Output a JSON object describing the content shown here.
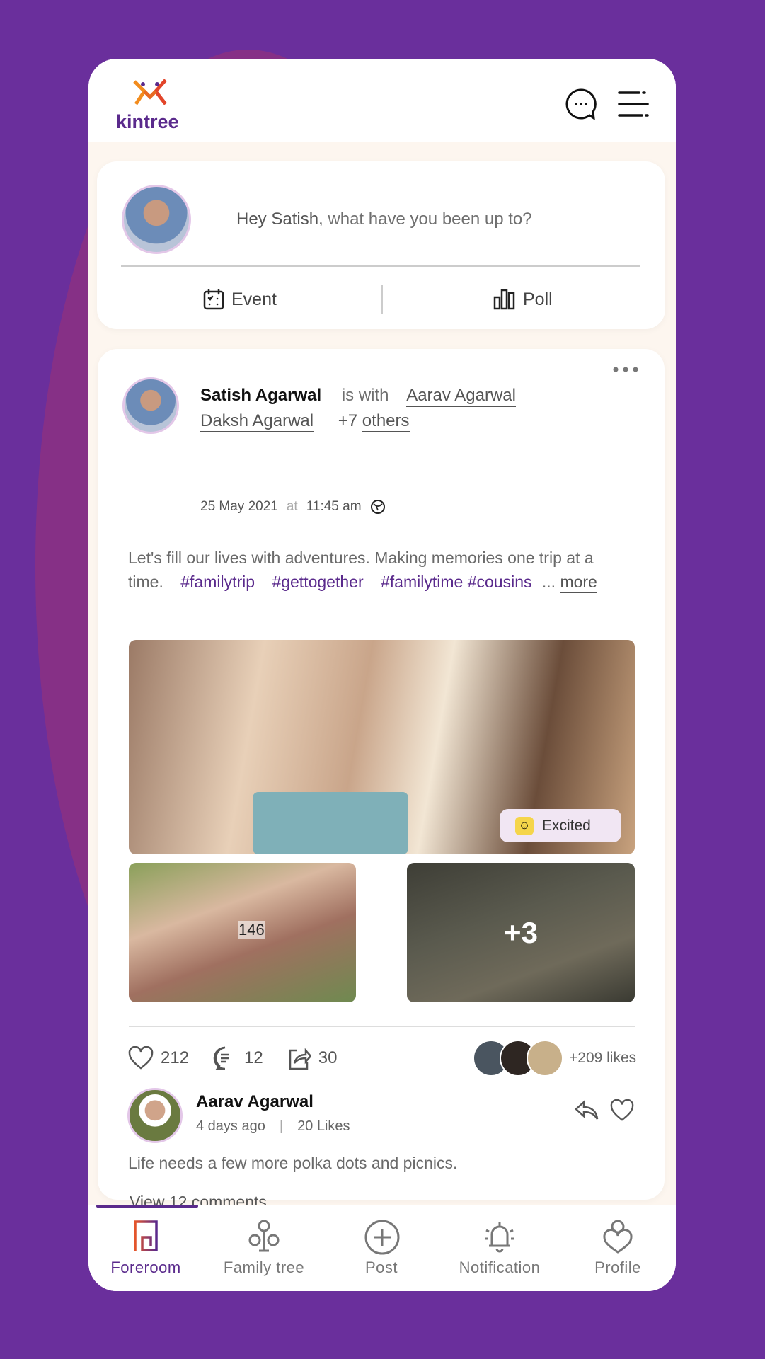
{
  "header": {
    "brand": "kintree",
    "icons": [
      "chat-icon",
      "menu-icon"
    ]
  },
  "composer": {
    "greeting_name": "Hey Satish,",
    "greeting_rest": " what have you been up to?",
    "event_label": "Event",
    "poll_label": "Poll"
  },
  "post": {
    "author": "Satish Agarwal",
    "is_with": "is with",
    "tagged": [
      "Aarav Agarwal",
      "Daksh Agarwal"
    ],
    "others_prefix": "+7",
    "others_label": "others",
    "date": "25 May 2021",
    "at": "at",
    "time": "11:45 am",
    "body": "Let's fill our lives with adventures. Making memories one trip at a time.",
    "hashtags": [
      "#familytrip",
      "#gettogether",
      "#familytime",
      "#cousins"
    ],
    "ellipsis": "...",
    "more": "more",
    "feeling": "Excited",
    "image_overlay_small": "146",
    "more_images": "+3",
    "likes": "212",
    "comments": "12",
    "shares": "30",
    "likes_summary": "+209 likes"
  },
  "comment": {
    "author": "Aarav Agarwal",
    "time": "4 days ago",
    "likes": "20 Likes",
    "text": "Life needs a few more polka dots and picnics.",
    "view_all": "View 12 comments"
  },
  "nav": {
    "items": [
      {
        "label": "Foreroom",
        "active": true
      },
      {
        "label": "Family tree"
      },
      {
        "label": "Post"
      },
      {
        "label": "Notification"
      },
      {
        "label": "Profile"
      }
    ]
  },
  "colors": {
    "background": "#6a2f9c",
    "accent": "#5a2a8c",
    "feed_bg": "#fdf6ef"
  }
}
